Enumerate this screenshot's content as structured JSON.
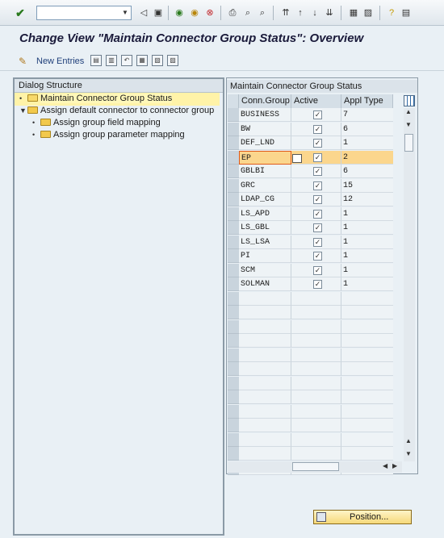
{
  "toolbar": {
    "command_field_value": "",
    "icons": [
      "check-icon",
      "back-icon",
      "save-icon",
      "green-back-icon",
      "exit-icon",
      "cancel-icon",
      "print-icon",
      "find-icon",
      "find-next-icon",
      "first-page-icon",
      "prev-page-icon",
      "next-page-icon",
      "last-page-icon",
      "create-session-icon",
      "shortcut-icon",
      "help-icon",
      "layout-icon"
    ]
  },
  "page": {
    "title": "Change View \"Maintain Connector Group Status\": Overview"
  },
  "app_toolbar": {
    "new_entries_label": "New Entries"
  },
  "dialog_structure": {
    "header": "Dialog Structure",
    "items": [
      {
        "label": "Maintain Connector Group Status",
        "selected": true
      },
      {
        "label": "Assign default connector to connector group",
        "selected": false
      },
      {
        "label": "Assign group field mapping",
        "selected": false
      },
      {
        "label": "Assign group parameter mapping",
        "selected": false
      }
    ]
  },
  "table": {
    "title": "Maintain Connector Group Status",
    "columns": [
      "Conn.Group",
      "Active",
      "Appl Type"
    ],
    "rows": [
      {
        "group": "BUSINESS",
        "active": true,
        "appl_type": "7"
      },
      {
        "group": "BW",
        "active": true,
        "appl_type": "6"
      },
      {
        "group": "DEF_LND",
        "active": true,
        "appl_type": "1"
      },
      {
        "group": "EP",
        "active": true,
        "appl_type": "2"
      },
      {
        "group": "GBLBI",
        "active": true,
        "appl_type": "6"
      },
      {
        "group": "GRC",
        "active": true,
        "appl_type": "15"
      },
      {
        "group": "LDAP_CG",
        "active": true,
        "appl_type": "12"
      },
      {
        "group": "LS_APD",
        "active": true,
        "appl_type": "1"
      },
      {
        "group": "LS_GBL",
        "active": true,
        "appl_type": "1"
      },
      {
        "group": "LS_LSA",
        "active": true,
        "appl_type": "1"
      },
      {
        "group": "PI",
        "active": true,
        "appl_type": "1"
      },
      {
        "group": "SCM",
        "active": true,
        "appl_type": "1"
      },
      {
        "group": "SOLMAN",
        "active": true,
        "appl_type": "1"
      }
    ]
  },
  "position_button": {
    "label": "Position..."
  }
}
